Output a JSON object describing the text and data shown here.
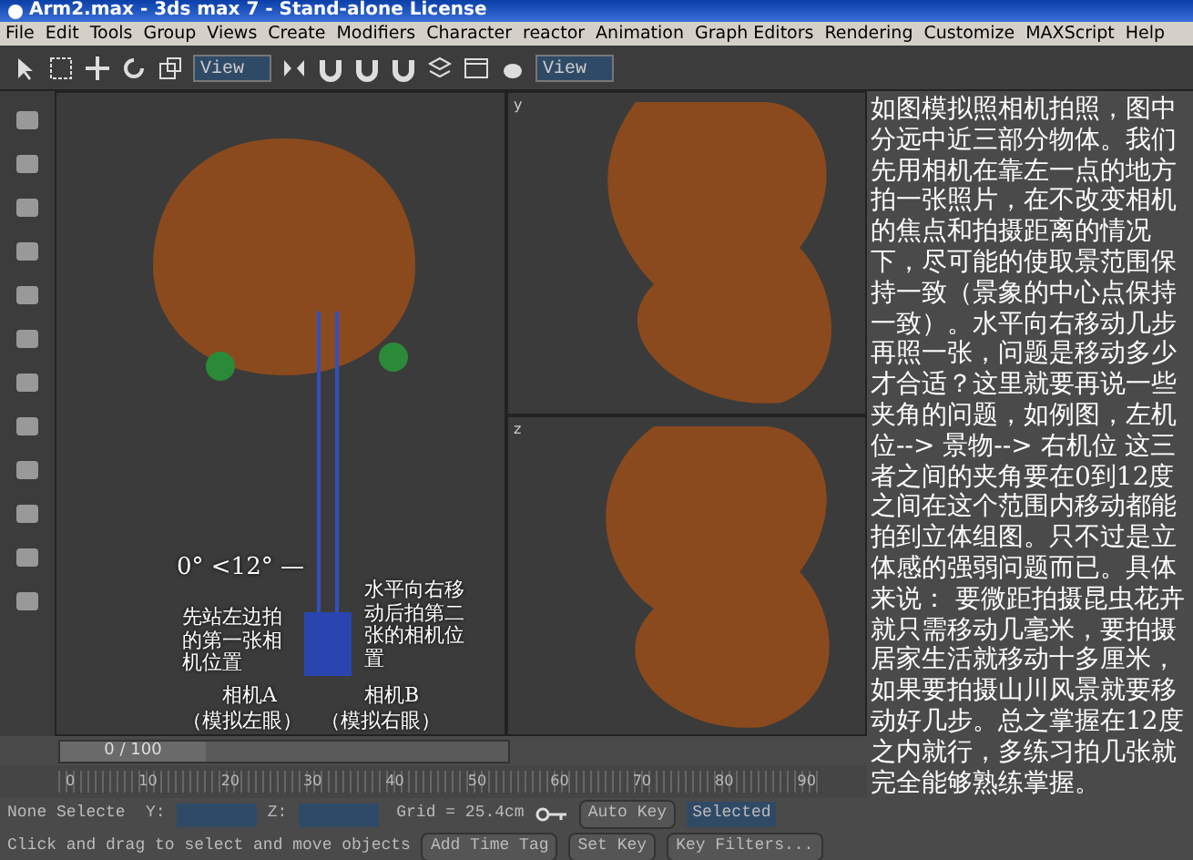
{
  "window": {
    "title": "Arm2.max - 3ds max 7  - Stand-alone License"
  },
  "menu": [
    "File",
    "Edit",
    "Tools",
    "Group",
    "Views",
    "Create",
    "Modifiers",
    "Character",
    "reactor",
    "Animation",
    "Graph Editors",
    "Rendering",
    "Customize",
    "MAXScript",
    "Help"
  ],
  "toolbar": {
    "dropdowns": [
      "View",
      "View"
    ]
  },
  "viewports": [
    {
      "label": "y"
    },
    {
      "label": "z"
    }
  ],
  "annotations": {
    "angle": "0° <12° —",
    "left_note": "先站左边拍的第一张相机位置",
    "right_note": "水平向右移动后拍第二张的相机位置",
    "camera_a": "相机A",
    "camera_a_note": "（模拟左眼）",
    "camera_b": "相机B",
    "camera_b_note": "（模拟右眼）",
    "explanation": "如图模拟照相机拍照，图中分远中近三部分物体。我们先用相机在靠左一点的地方拍一张照片，在不改变相机的焦点和拍摄距离的情况下，尽可能的使取景范围保持一致（景象的中心点保持一致）。水平向右移动几步再照一张，问题是移动多少才合适？这里就要再说一些夹角的问题，如例图，左机位--> 景物--> 右机位 这三者之间的夹角要在0到12度之间在这个范围内移动都能拍到立体组图。只不过是立体感的强弱问题而已。具体来说： 要微距拍摄昆虫花卉就只需移动几毫米，要拍摄居家生活就移动十多厘米，如果要拍摄山川风景就要移动好几步。总之掌握在12度之内就行，多练习拍几张就完全能够熟练掌握。"
  },
  "time_slider": {
    "frame": "0 / 100",
    "level": 0
  },
  "trackbar": {
    "ticks": [
      "0",
      "10",
      "20",
      "30",
      "40",
      "50",
      "60",
      "70",
      "80",
      "90"
    ]
  },
  "status_bar": {
    "selection": "None Selecte",
    "y_label": "Y:",
    "z_label": "Z:",
    "grid": "Grid = 25.4cm",
    "auto_key": "Auto Key",
    "key_mode": "Selected",
    "prompt": "Click and drag to select and move objects",
    "add_time_tag": "Add Time Tag",
    "set_key": "Set Key",
    "key_filters": "Key Filters..."
  }
}
